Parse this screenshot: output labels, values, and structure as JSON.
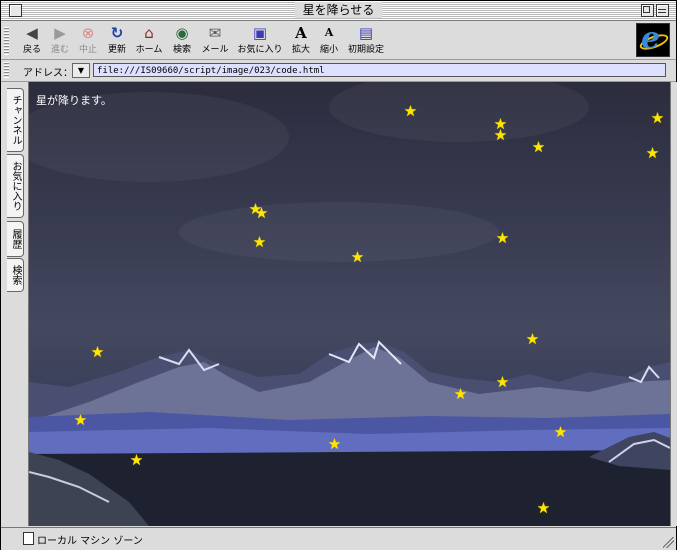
{
  "window": {
    "title": "星を降らせる"
  },
  "toolbar": {
    "buttons": [
      {
        "label": "戻る",
        "icon": "back-arrow-icon"
      },
      {
        "label": "進む",
        "icon": "forward-arrow-icon"
      },
      {
        "label": "中止",
        "icon": "stop-icon"
      },
      {
        "label": "更新",
        "icon": "refresh-icon"
      },
      {
        "label": "ホーム",
        "icon": "home-icon"
      },
      {
        "label": "検索",
        "icon": "search-icon"
      },
      {
        "label": "メール",
        "icon": "mail-icon"
      },
      {
        "label": "お気に入り",
        "icon": "favorites-icon"
      },
      {
        "label": "拡大",
        "icon": "text-larger-icon"
      },
      {
        "label": "縮小",
        "icon": "text-smaller-icon"
      },
      {
        "label": "初期設定",
        "icon": "preferences-icon"
      }
    ]
  },
  "address": {
    "label": "アドレス：",
    "url": "file:///IS09660/script/image/023/code.html"
  },
  "sidebar": {
    "tabs": [
      "チャンネル",
      "お気に入り",
      "履歴",
      "検索"
    ]
  },
  "page": {
    "text": "星が降ります。",
    "star_glyph": "★",
    "star_color": "#ffe600"
  },
  "status": {
    "text": "ローカル マシン ゾーン"
  },
  "colors": {
    "accent_ie": "#3a8ad8",
    "address_field_bg": "#dde0ff"
  }
}
